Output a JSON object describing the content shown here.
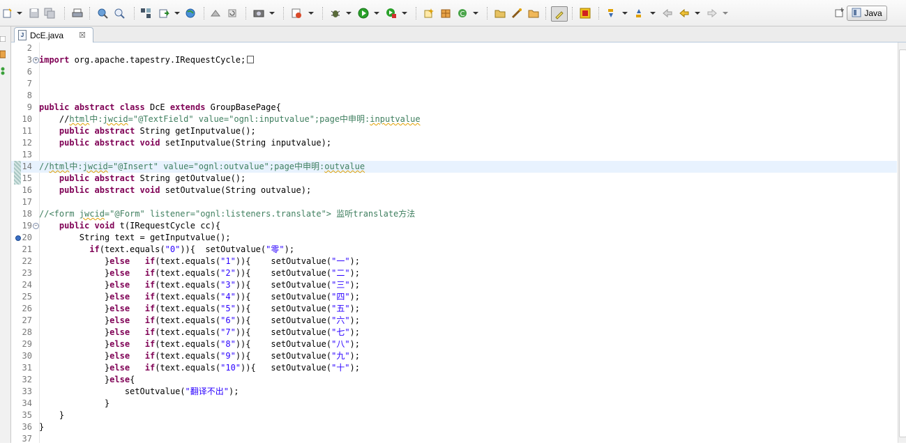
{
  "toolbar": {
    "perspective_label": "Java",
    "icons": [
      "new-icon",
      "save-icon",
      "save-all-icon",
      "print-icon",
      "open-type-icon",
      "search-icon",
      "build-icon",
      "refactor-icon",
      "web-icon",
      "server-icon",
      "camera-icon",
      "task-icon",
      "debug-icon",
      "run-icon",
      "run-ext-icon",
      "new-class-icon",
      "package-icon",
      "refresh-icon",
      "open-folder-icon",
      "wand-icon",
      "folder-icon",
      "highlight-icon",
      "stop-icon",
      "next-annotation-icon",
      "prev-annotation-icon",
      "last-edit-icon",
      "back-icon",
      "forward-icon"
    ]
  },
  "editor_tab": {
    "label": "DcE.java",
    "close_glyph": "☒"
  },
  "code": {
    "lines": [
      {
        "n": "2",
        "segs": []
      },
      {
        "n": "3",
        "fold": "+",
        "segs": [
          {
            "t": "import",
            "c": "kw"
          },
          {
            "t": " org.apache.tapestry.IRequestCycle;"
          }
        ],
        "collapsed": true
      },
      {
        "n": "6",
        "segs": []
      },
      {
        "n": "7",
        "segs": []
      },
      {
        "n": "8",
        "segs": []
      },
      {
        "n": "9",
        "segs": [
          {
            "t": "public",
            "c": "kw"
          },
          {
            "t": " "
          },
          {
            "t": "abstract",
            "c": "kw"
          },
          {
            "t": " "
          },
          {
            "t": "class",
            "c": "kw"
          },
          {
            "t": " DcE "
          },
          {
            "t": "extends",
            "c": "kw"
          },
          {
            "t": " GroupBasePage{"
          }
        ]
      },
      {
        "n": "10",
        "segs": [
          {
            "t": "    //"
          },
          {
            "t": "html",
            "c": "cm squig"
          },
          {
            "t": "中:",
            "c": "cm"
          },
          {
            "t": "jwcid",
            "c": "cm squig"
          },
          {
            "t": "=\"@TextField\" value=\"ognl:inputvalue\";page中申明:",
            "c": "cm"
          },
          {
            "t": "inputvalue",
            "c": "cm squig"
          }
        ],
        "cm_lead": true
      },
      {
        "n": "11",
        "segs": [
          {
            "t": "    "
          },
          {
            "t": "public",
            "c": "kw"
          },
          {
            "t": " "
          },
          {
            "t": "abstract",
            "c": "kw"
          },
          {
            "t": " String getInputvalue();"
          }
        ]
      },
      {
        "n": "12",
        "segs": [
          {
            "t": "    "
          },
          {
            "t": "public",
            "c": "kw"
          },
          {
            "t": " "
          },
          {
            "t": "abstract",
            "c": "kw"
          },
          {
            "t": " "
          },
          {
            "t": "void",
            "c": "kw"
          },
          {
            "t": " setInputvalue(String inputvalue);"
          }
        ]
      },
      {
        "n": "13",
        "segs": []
      },
      {
        "n": "14",
        "current": true,
        "change": true,
        "segs": [
          {
            "t": "//",
            "c": "cm"
          },
          {
            "t": "html",
            "c": "cm squig"
          },
          {
            "t": "中:",
            "c": "cm"
          },
          {
            "t": "jwcid",
            "c": "cm squig"
          },
          {
            "t": "=\"@Insert\" value=\"ognl:outvalue\";page中申明:",
            "c": "cm"
          },
          {
            "t": "outvalue",
            "c": "cm squig"
          }
        ]
      },
      {
        "n": "15",
        "change": true,
        "segs": [
          {
            "t": "    "
          },
          {
            "t": "public",
            "c": "kw"
          },
          {
            "t": " "
          },
          {
            "t": "abstract",
            "c": "kw"
          },
          {
            "t": " String getOutvalue();"
          }
        ]
      },
      {
        "n": "16",
        "segs": [
          {
            "t": "    "
          },
          {
            "t": "public",
            "c": "kw"
          },
          {
            "t": " "
          },
          {
            "t": "abstract",
            "c": "kw"
          },
          {
            "t": " "
          },
          {
            "t": "void",
            "c": "kw"
          },
          {
            "t": " setOutvalue(String outvalue);"
          }
        ]
      },
      {
        "n": "17",
        "segs": []
      },
      {
        "n": "18",
        "segs": [
          {
            "t": "//<form ",
            "c": "cm"
          },
          {
            "t": "jwcid",
            "c": "cm squig"
          },
          {
            "t": "=\"@Form\" listener=\"ognl:listeners.translate\"> 监听translate方法",
            "c": "cm"
          }
        ]
      },
      {
        "n": "19",
        "fold": "-",
        "segs": [
          {
            "t": "    "
          },
          {
            "t": "public",
            "c": "kw"
          },
          {
            "t": " "
          },
          {
            "t": "void",
            "c": "kw"
          },
          {
            "t": " t(IRequestCycle cc){"
          }
        ]
      },
      {
        "n": "20",
        "override": true,
        "segs": [
          {
            "t": "        String text = getInputvalue();"
          }
        ]
      },
      {
        "n": "21",
        "segs": [
          {
            "t": "          "
          },
          {
            "t": "if",
            "c": "kw"
          },
          {
            "t": "(text.equals("
          },
          {
            "t": "\"0\"",
            "c": "str"
          },
          {
            "t": ")){  setOutvalue("
          },
          {
            "t": "\"零\"",
            "c": "str"
          },
          {
            "t": ");"
          }
        ]
      },
      {
        "n": "22",
        "segs": [
          {
            "t": "             }"
          },
          {
            "t": "else",
            "c": "kw"
          },
          {
            "t": "   "
          },
          {
            "t": "if",
            "c": "kw"
          },
          {
            "t": "(text.equals("
          },
          {
            "t": "\"1\"",
            "c": "str"
          },
          {
            "t": ")){    setOutvalue("
          },
          {
            "t": "\"一\"",
            "c": "str"
          },
          {
            "t": ");"
          }
        ]
      },
      {
        "n": "23",
        "segs": [
          {
            "t": "             }"
          },
          {
            "t": "else",
            "c": "kw"
          },
          {
            "t": "   "
          },
          {
            "t": "if",
            "c": "kw"
          },
          {
            "t": "(text.equals("
          },
          {
            "t": "\"2\"",
            "c": "str"
          },
          {
            "t": ")){    setOutvalue("
          },
          {
            "t": "\"二\"",
            "c": "str"
          },
          {
            "t": ");"
          }
        ]
      },
      {
        "n": "24",
        "segs": [
          {
            "t": "             }"
          },
          {
            "t": "else",
            "c": "kw"
          },
          {
            "t": "   "
          },
          {
            "t": "if",
            "c": "kw"
          },
          {
            "t": "(text.equals("
          },
          {
            "t": "\"3\"",
            "c": "str"
          },
          {
            "t": ")){    setOutvalue("
          },
          {
            "t": "\"三\"",
            "c": "str"
          },
          {
            "t": ");"
          }
        ]
      },
      {
        "n": "25",
        "segs": [
          {
            "t": "             }"
          },
          {
            "t": "else",
            "c": "kw"
          },
          {
            "t": "   "
          },
          {
            "t": "if",
            "c": "kw"
          },
          {
            "t": "(text.equals("
          },
          {
            "t": "\"4\"",
            "c": "str"
          },
          {
            "t": ")){    setOutvalue("
          },
          {
            "t": "\"四\"",
            "c": "str"
          },
          {
            "t": ");"
          }
        ]
      },
      {
        "n": "26",
        "segs": [
          {
            "t": "             }"
          },
          {
            "t": "else",
            "c": "kw"
          },
          {
            "t": "   "
          },
          {
            "t": "if",
            "c": "kw"
          },
          {
            "t": "(text.equals("
          },
          {
            "t": "\"5\"",
            "c": "str"
          },
          {
            "t": ")){    setOutvalue("
          },
          {
            "t": "\"五\"",
            "c": "str"
          },
          {
            "t": ");"
          }
        ]
      },
      {
        "n": "27",
        "segs": [
          {
            "t": "             }"
          },
          {
            "t": "else",
            "c": "kw"
          },
          {
            "t": "   "
          },
          {
            "t": "if",
            "c": "kw"
          },
          {
            "t": "(text.equals("
          },
          {
            "t": "\"6\"",
            "c": "str"
          },
          {
            "t": ")){    setOutvalue("
          },
          {
            "t": "\"六\"",
            "c": "str"
          },
          {
            "t": ");"
          }
        ]
      },
      {
        "n": "28",
        "segs": [
          {
            "t": "             }"
          },
          {
            "t": "else",
            "c": "kw"
          },
          {
            "t": "   "
          },
          {
            "t": "if",
            "c": "kw"
          },
          {
            "t": "(text.equals("
          },
          {
            "t": "\"7\"",
            "c": "str"
          },
          {
            "t": ")){    setOutvalue("
          },
          {
            "t": "\"七\"",
            "c": "str"
          },
          {
            "t": ");"
          }
        ]
      },
      {
        "n": "29",
        "segs": [
          {
            "t": "             }"
          },
          {
            "t": "else",
            "c": "kw"
          },
          {
            "t": "   "
          },
          {
            "t": "if",
            "c": "kw"
          },
          {
            "t": "(text.equals("
          },
          {
            "t": "\"8\"",
            "c": "str"
          },
          {
            "t": ")){    setOutvalue("
          },
          {
            "t": "\"八\"",
            "c": "str"
          },
          {
            "t": ");"
          }
        ]
      },
      {
        "n": "30",
        "segs": [
          {
            "t": "             }"
          },
          {
            "t": "else",
            "c": "kw"
          },
          {
            "t": "   "
          },
          {
            "t": "if",
            "c": "kw"
          },
          {
            "t": "(text.equals("
          },
          {
            "t": "\"9\"",
            "c": "str"
          },
          {
            "t": ")){    setOutvalue("
          },
          {
            "t": "\"九\"",
            "c": "str"
          },
          {
            "t": ");"
          }
        ]
      },
      {
        "n": "31",
        "segs": [
          {
            "t": "             }"
          },
          {
            "t": "else",
            "c": "kw"
          },
          {
            "t": "   "
          },
          {
            "t": "if",
            "c": "kw"
          },
          {
            "t": "(text.equals("
          },
          {
            "t": "\"10\"",
            "c": "str"
          },
          {
            "t": ")){   setOutvalue("
          },
          {
            "t": "\"十\"",
            "c": "str"
          },
          {
            "t": ");"
          }
        ]
      },
      {
        "n": "32",
        "segs": [
          {
            "t": "             }"
          },
          {
            "t": "else",
            "c": "kw"
          },
          {
            "t": "{"
          }
        ]
      },
      {
        "n": "33",
        "segs": [
          {
            "t": "                 setOutvalue("
          },
          {
            "t": "\"翻译不出\"",
            "c": "str"
          },
          {
            "t": ");"
          }
        ]
      },
      {
        "n": "34",
        "segs": [
          {
            "t": "             }"
          }
        ]
      },
      {
        "n": "35",
        "segs": [
          {
            "t": "    }"
          }
        ]
      },
      {
        "n": "36",
        "segs": [
          {
            "t": "}"
          }
        ]
      },
      {
        "n": "37",
        "segs": []
      }
    ]
  },
  "colors": {
    "keyword": "#7f0055",
    "comment": "#3f7f5f",
    "string": "#2a00ff",
    "current_line": "#e8f2fe"
  }
}
